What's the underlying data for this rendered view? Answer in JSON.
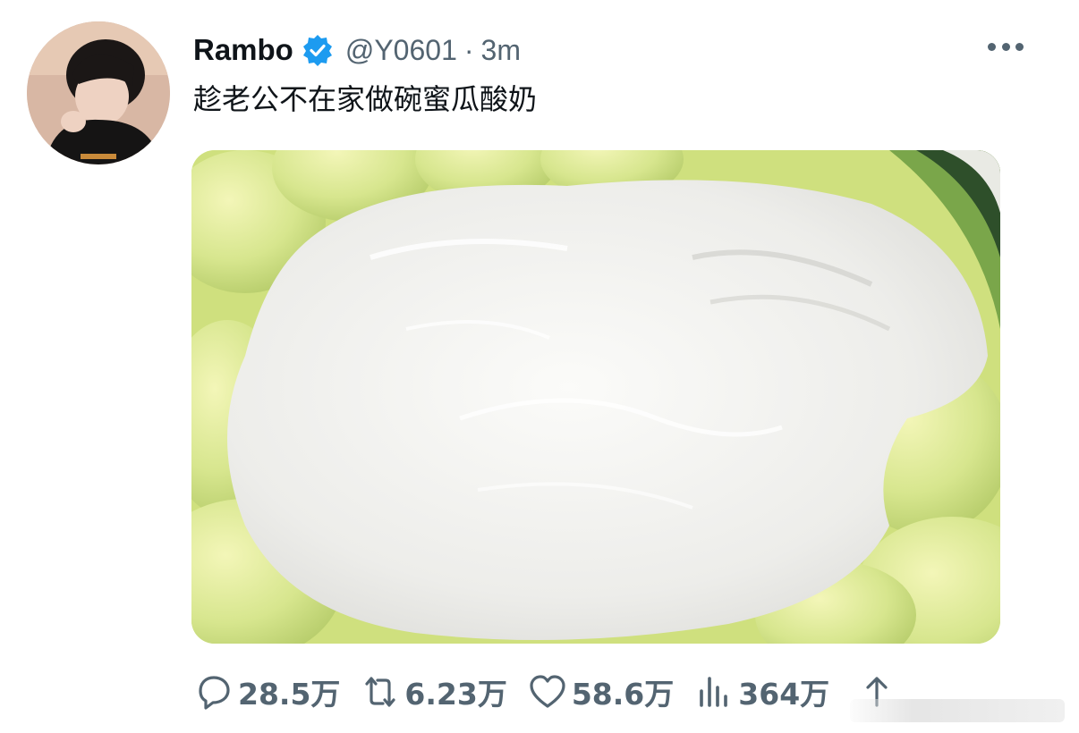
{
  "tweet": {
    "author_name": "Rambo",
    "handle": "@Y0601",
    "separator": "·",
    "time": "3m",
    "text": "趁老公不在家做碗蜜瓜酸奶"
  },
  "actions": {
    "reply_count": "28.5万",
    "retweet_count": "6.23万",
    "like_count": "58.6万",
    "views_count": "364万"
  },
  "icons": {
    "verified": "verified-badge-icon",
    "more": "more-options-icon",
    "reply": "reply-icon",
    "retweet": "retweet-icon",
    "like": "heart-icon",
    "views": "views-bar-chart-icon",
    "share": "share-icon"
  },
  "colors": {
    "verified": "#1d9bf0",
    "secondary_text": "#536471",
    "primary_text": "#0f1419",
    "melon_green": "#d6e78a",
    "yogurt_white": "#f2f2ef"
  }
}
